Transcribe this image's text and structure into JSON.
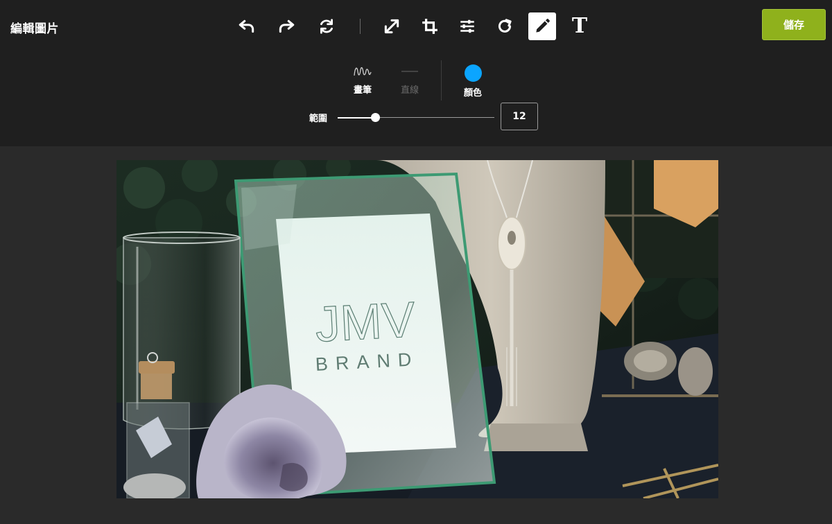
{
  "header": {
    "title": "編輯圖片",
    "save_label": "儲存",
    "accent_color": "#8fb11c"
  },
  "toolbar": {
    "tools": [
      {
        "name": "undo-icon"
      },
      {
        "name": "redo-icon"
      },
      {
        "name": "reset-icon"
      },
      {
        "name": "resize-icon"
      },
      {
        "name": "crop-icon"
      },
      {
        "name": "adjust-icon"
      },
      {
        "name": "rotate-icon"
      },
      {
        "name": "draw-icon",
        "active": true
      },
      {
        "name": "text-icon",
        "glyph": "T"
      }
    ]
  },
  "draw_options": {
    "brush_label": "畫筆",
    "line_label": "直線",
    "color_label": "顏色",
    "color_value": "#0ba5ff",
    "range_label": "範圍",
    "range_value": "12",
    "range_max": 50
  },
  "photo": {
    "sign_logo": "JMV",
    "sign_text": "BRAND"
  }
}
